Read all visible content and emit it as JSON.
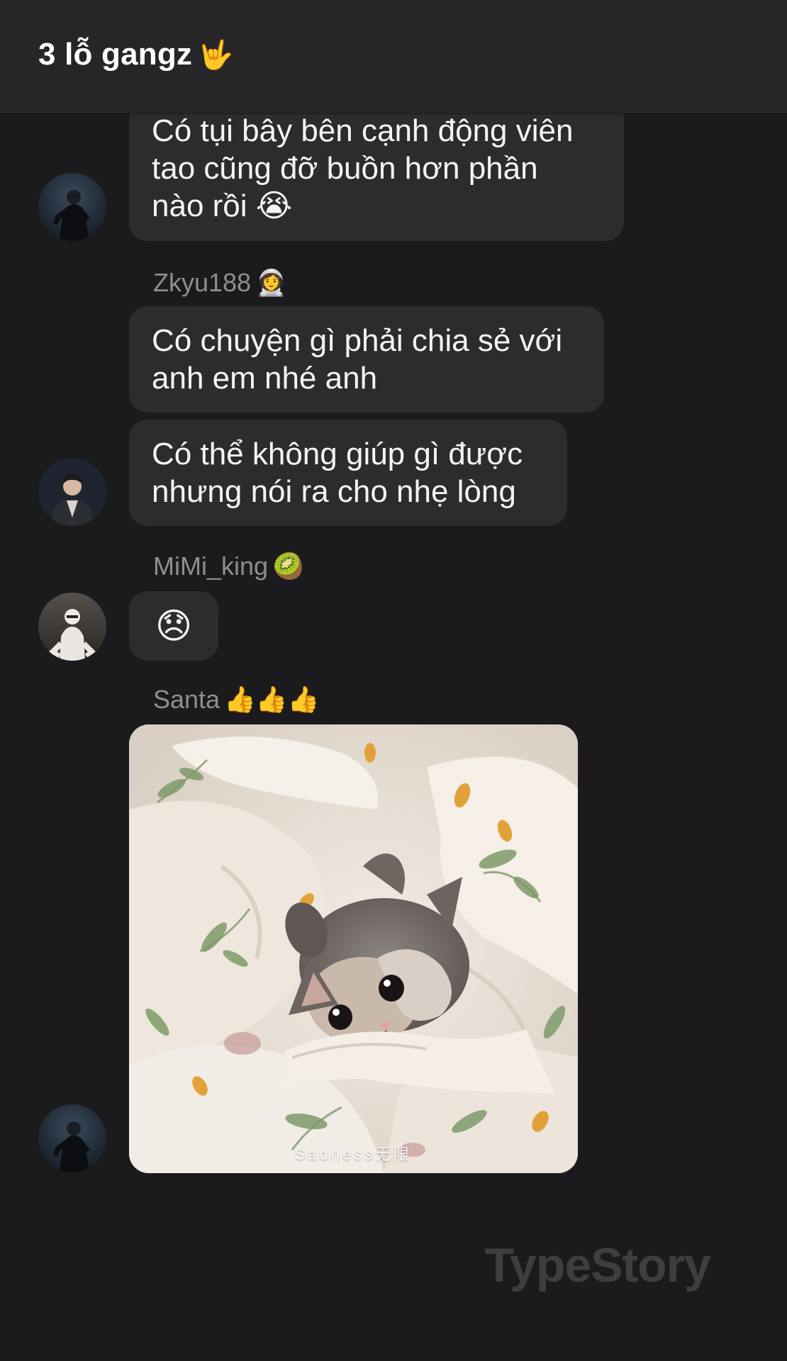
{
  "header": {
    "title": "3 lỗ gangz",
    "title_emoji": "🤟"
  },
  "messages": [
    {
      "lines": [
        "Có tụi bây bên cạnh động viên",
        "tao cũng đỡ buồn hơn phần",
        "nào rồi 😭"
      ]
    },
    {
      "sender": "Zkyu188",
      "sender_emoji": "👩‍🚀",
      "bubbles": [
        {
          "lines": [
            "Có chuyện gì phải chia sẻ với",
            "anh em nhé anh"
          ]
        },
        {
          "lines": [
            "Có thể không giúp gì được",
            "nhưng nói ra cho nhẹ lòng"
          ]
        }
      ]
    },
    {
      "sender": "MiMi_king",
      "sender_emoji": "🥝",
      "text": "😞"
    },
    {
      "sender": "Santa",
      "sender_emoji": "👍👍👍",
      "image_caption": "Sadness无限",
      "image_subject": "kitten-in-blanket"
    }
  ],
  "watermark": "TypeStory",
  "colors": {
    "background": "#1b1b1d",
    "header": "#262628",
    "bubble": "#2c2c2e",
    "sender_text": "#8e8e93",
    "message_text": "#f4f4f5"
  }
}
